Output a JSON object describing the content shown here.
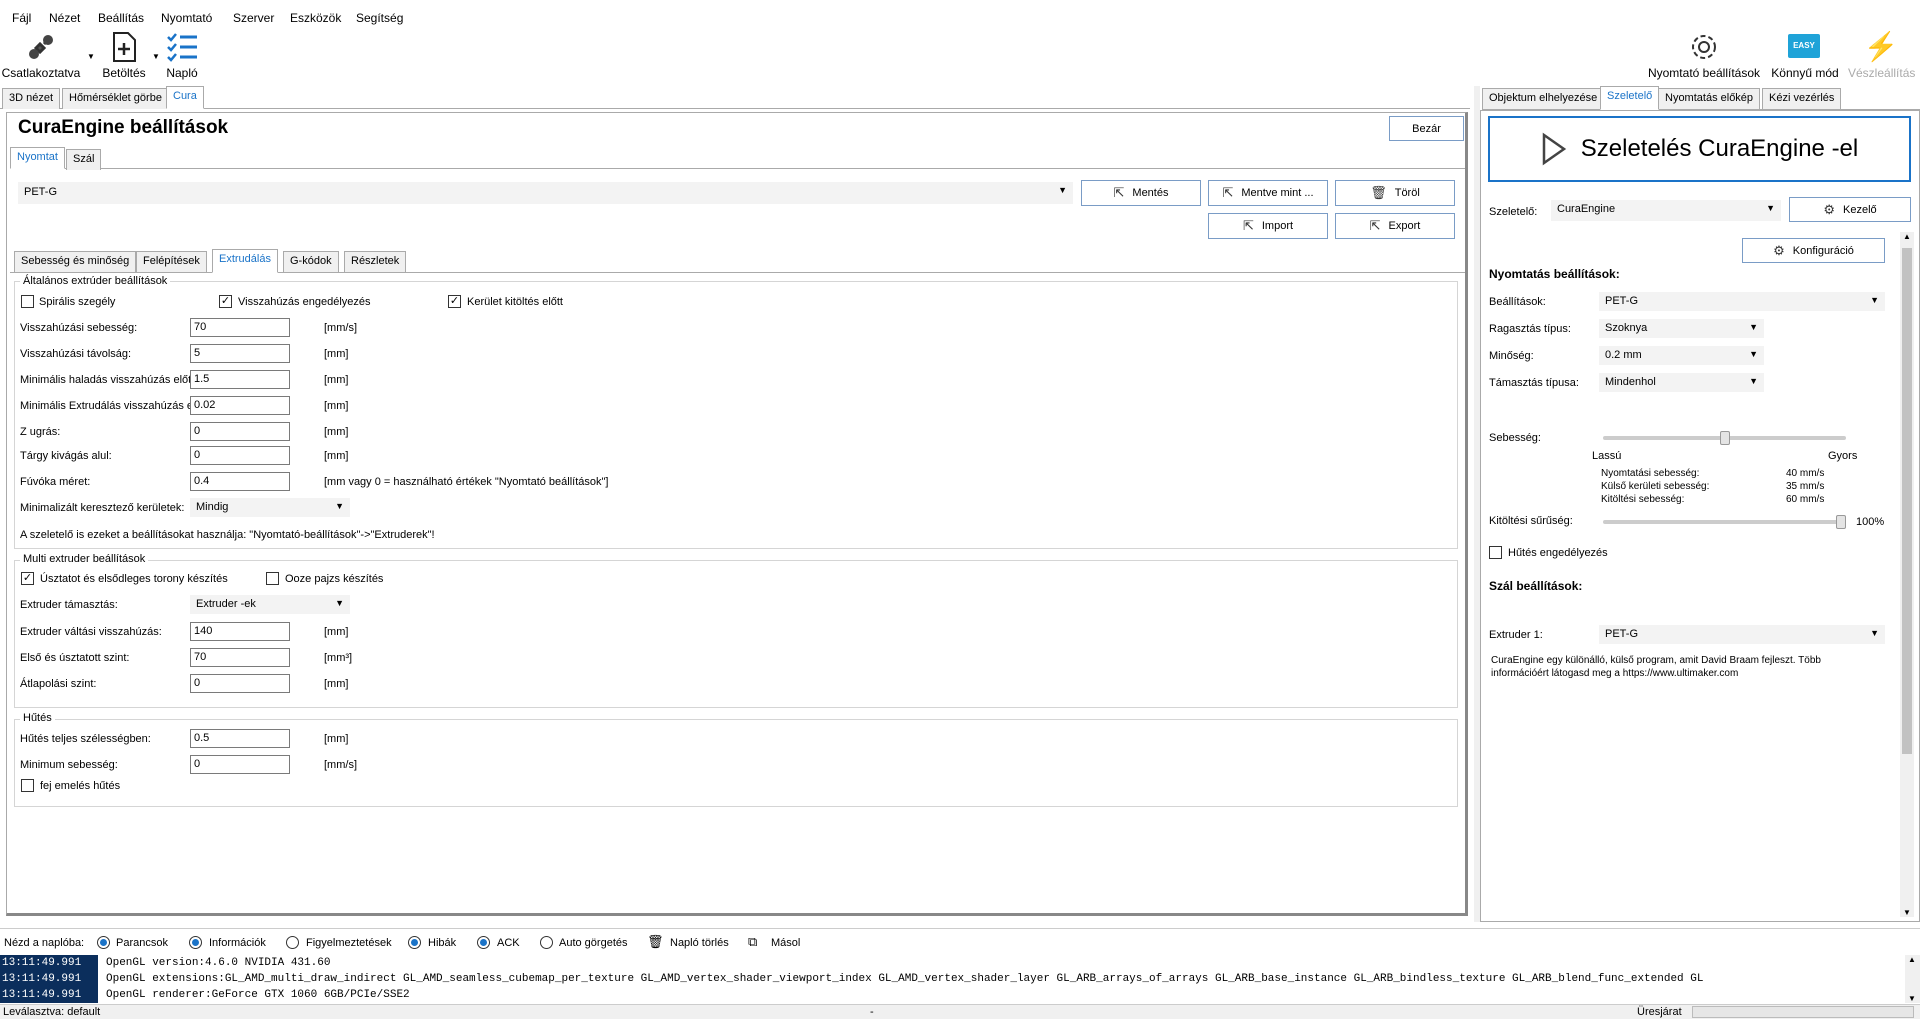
{
  "menu": [
    "Fájl",
    "Nézet",
    "Beállítás",
    "Nyomtató",
    "Szerver",
    "Eszközök",
    "Segítség"
  ],
  "toolbar": {
    "connect": "Csatlakoztatva",
    "load": "Betöltés",
    "log": "Napló",
    "printer_settings": "Nyomtató beállítások",
    "easy_mode": "Könnyű mód",
    "easy_badge": "EASY",
    "emergency": "Vészleállítás"
  },
  "left_tabs": [
    "3D nézet",
    "Hőmérséklet görbe",
    "Cura"
  ],
  "engine": {
    "title": "CuraEngine beállítások",
    "close": "Bezár",
    "tabs": [
      "Nyomtat",
      "Szál"
    ],
    "profile": "PET-G",
    "buttons": {
      "save": "Mentés",
      "save_as": "Mentve mint ...",
      "delete": "Töröl",
      "import": "Import",
      "export": "Export"
    },
    "subtabs": [
      "Sebesség és minőség",
      "Felépítések",
      "Extrudálás",
      "G-kódok",
      "Részletek"
    ],
    "general": {
      "title": "Általános extrúder beállítások",
      "spiral": "Spirális szegély",
      "retract_enable": "Visszahúzás engedélyezés",
      "perimeter_before": "Kerület kitöltés előtt",
      "rows": [
        {
          "label": "Visszahúzási sebesség:",
          "value": "70",
          "unit": "[mm/s]"
        },
        {
          "label": "Visszahúzási távolság:",
          "value": "5",
          "unit": "[mm]"
        },
        {
          "label": "Minimális haladás visszahúzás előtt:",
          "value": "1.5",
          "unit": "[mm]"
        },
        {
          "label": "Minimális Extrudálás visszahúzás előtt:",
          "value": "0.02",
          "unit": "[mm]"
        },
        {
          "label": "Z ugrás:",
          "value": "0",
          "unit": "[mm]"
        },
        {
          "label": "Tárgy kivágás alul:",
          "value": "0",
          "unit": "[mm]"
        },
        {
          "label": "Fúvóka méret:",
          "value": "0.4",
          "unit": "[mm vagy 0 = használható értékek \"Nyomtató beállítások\"]"
        }
      ],
      "minimize_label": "Minimalizált keresztező kerületek:",
      "minimize_value": "Mindig",
      "note": "A szeletelő is ezeket a beállításokat használja: \"Nyomtató-beállítások\"->\"Extruderek\"!"
    },
    "multi": {
      "title": "Multi extruder beállítások",
      "wipe_tower": "Úsztatot és elsődleges torony készítés",
      "ooze": "Ooze pajzs készítés",
      "support_label": "Extruder támasztás:",
      "support_value": "Extruder -ek",
      "rows": [
        {
          "label": "Extruder váltási visszahúzás:",
          "value": "140",
          "unit": "[mm]"
        },
        {
          "label": "Első és úsztatott szint:",
          "value": "70",
          "unit": "[mm³]"
        },
        {
          "label": "Átlapolási szint:",
          "value": "0",
          "unit": "[mm]"
        }
      ]
    },
    "cooling": {
      "title": "Hűtés",
      "rows": [
        {
          "label": "Hűtés teljes szélességben:",
          "value": "0.5",
          "unit": "[mm]"
        },
        {
          "label": "Minimum sebesség:",
          "value": "0",
          "unit": "[mm/s]"
        }
      ],
      "head_lift": "fej emelés hűtés"
    }
  },
  "right_tabs": [
    "Objektum elhelyezése",
    "Szeletelő",
    "Nyomtatás előkép",
    "Kézi vezérlés"
  ],
  "slicer": {
    "slice_button": "Szeletelés CuraEngine -el",
    "slicer_label": "Szeletelő:",
    "slicer_value": "CuraEngine",
    "manage": "Kezelő",
    "config": "Konfiguráció",
    "print_settings_title": "Nyomtatás beállítások:",
    "settings_label": "Beállítások:",
    "settings_value": "PET-G",
    "adhesion_label": "Ragasztás típus:",
    "adhesion_value": "Szoknya",
    "quality_label": "Minőség:",
    "quality_value": "0.2 mm",
    "support_label": "Támasztás típusa:",
    "support_value": "Mindenhol",
    "speed_label": "Sebesség:",
    "speed_slow": "Lassú",
    "speed_fast": "Gyors",
    "speed_level": 0.5,
    "speeds": [
      {
        "label": "Nyomtatási sebesség:",
        "value": "40 mm/s"
      },
      {
        "label": "Külső kerületi sebesség:",
        "value": "35 mm/s"
      },
      {
        "label": "Kitöltési sebesség:",
        "value": "60 mm/s"
      }
    ],
    "infill_label": "Kitöltési sűrűség:",
    "infill_value": "100%",
    "cooling_enable": "Hűtés engedélyezés",
    "filament_title": "Szál beállítások:",
    "extruder_label": "Extruder 1:",
    "extruder_value": "PET-G",
    "info": "CuraEngine egy különálló, külső program, amit David Braam fejleszt. Több információért látogasd meg a https://www.ultimaker.com"
  },
  "logbar": {
    "show_label": "Nézd a naplóba:",
    "commands": "Parancsok",
    "info": "Információk",
    "warnings": "Figyelmeztetések",
    "errors": "Hibák",
    "ack": "ACK",
    "autoscroll": "Auto görgetés",
    "clear": "Napló törlés",
    "copy": "Másol"
  },
  "log": [
    {
      "ts": "13:11:49.991",
      "msg": "OpenGL version:4.6.0 NVIDIA 431.60"
    },
    {
      "ts": "13:11:49.991",
      "msg": "OpenGL extensions:GL_AMD_multi_draw_indirect GL_AMD_seamless_cubemap_per_texture GL_AMD_vertex_shader_viewport_index GL_AMD_vertex_shader_layer GL_ARB_arrays_of_arrays GL_ARB_base_instance GL_ARB_bindless_texture GL_ARB_blend_func_extended GL"
    },
    {
      "ts": "13:11:49.991",
      "msg": "OpenGL renderer:GeForce GTX 1060 6GB/PCIe/SSE2"
    }
  ],
  "status": {
    "left": "Leválasztva: default",
    "mid": "-",
    "right": "Üresjárat"
  }
}
